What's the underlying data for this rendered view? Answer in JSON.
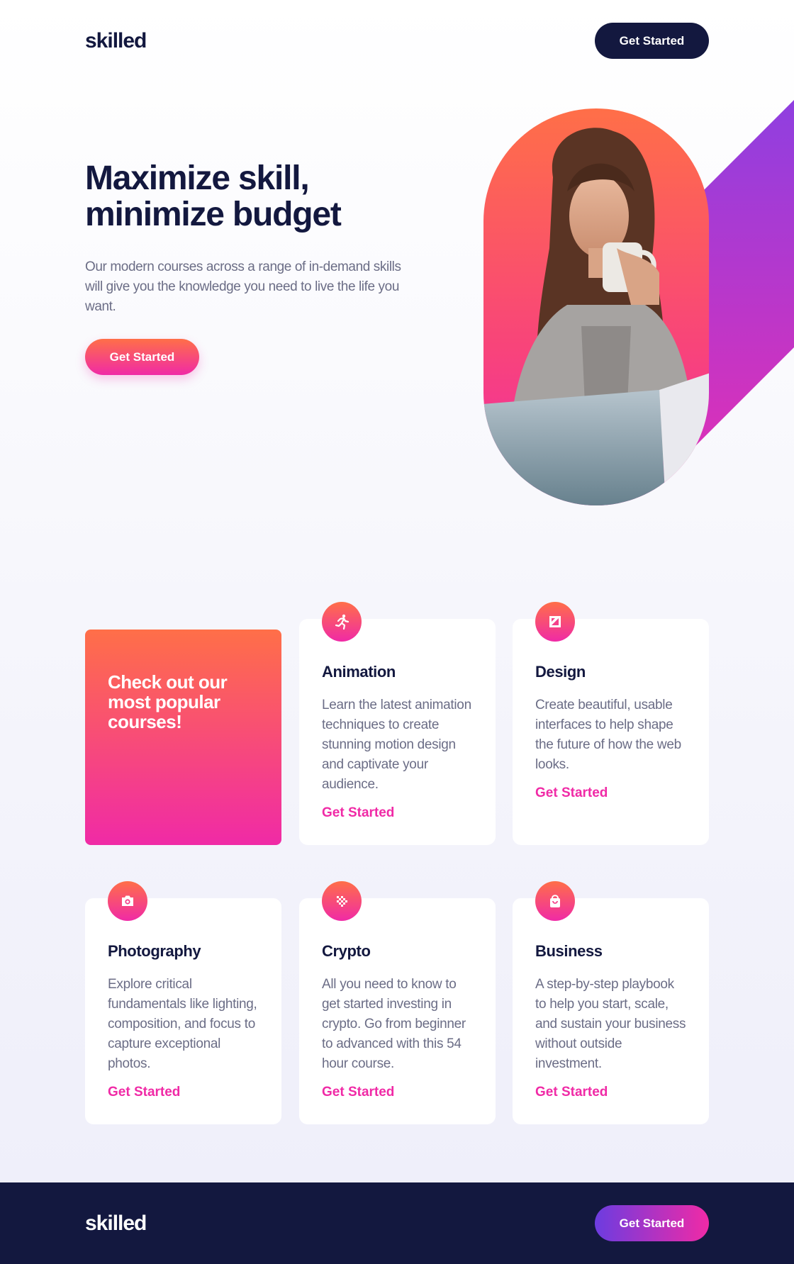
{
  "header": {
    "logo": "skilled",
    "cta_label": "Get Started"
  },
  "hero": {
    "title_line1": "Maximize skill,",
    "title_line2": "minimize budget",
    "text": "Our modern courses across a range of in-demand skills will give you the knowledge you need to live the life you want.",
    "cta_label": "Get Started"
  },
  "promo": {
    "line1": "Check out our",
    "line2": "most popular",
    "line3": "courses!"
  },
  "courses": [
    {
      "icon": "running-person-icon",
      "title": "Animation",
      "text": "Learn the latest animation techniques to create stunning motion design and captivate your audience.",
      "link": "Get Started"
    },
    {
      "icon": "design-square-icon",
      "title": "Design",
      "text": "Create beautiful, usable interfaces to help shape the future of how the web looks.",
      "link": "Get Started"
    },
    {
      "icon": "camera-icon",
      "title": "Photography",
      "text": "Explore critical fundamentals like lighting, composition, and focus to capture exceptional photos.",
      "link": "Get Started"
    },
    {
      "icon": "crypto-dots-icon",
      "title": "Crypto",
      "text": "All you need to know to get started investing in crypto. Go from beginner to advanced with this 54 hour course.",
      "link": "Get Started"
    },
    {
      "icon": "shopping-bag-icon",
      "title": "Business",
      "text": "A step-by-step playbook to help you start, scale, and sustain your business without outside investment.",
      "link": "Get Started"
    }
  ],
  "footer": {
    "logo": "skilled",
    "cta_label": "Get Started"
  },
  "colors": {
    "navy": "#13183f",
    "orange": "#ff6f48",
    "pink": "#f02aa6",
    "purple": "#6c3ce0",
    "gray_text": "#6b6d86"
  }
}
